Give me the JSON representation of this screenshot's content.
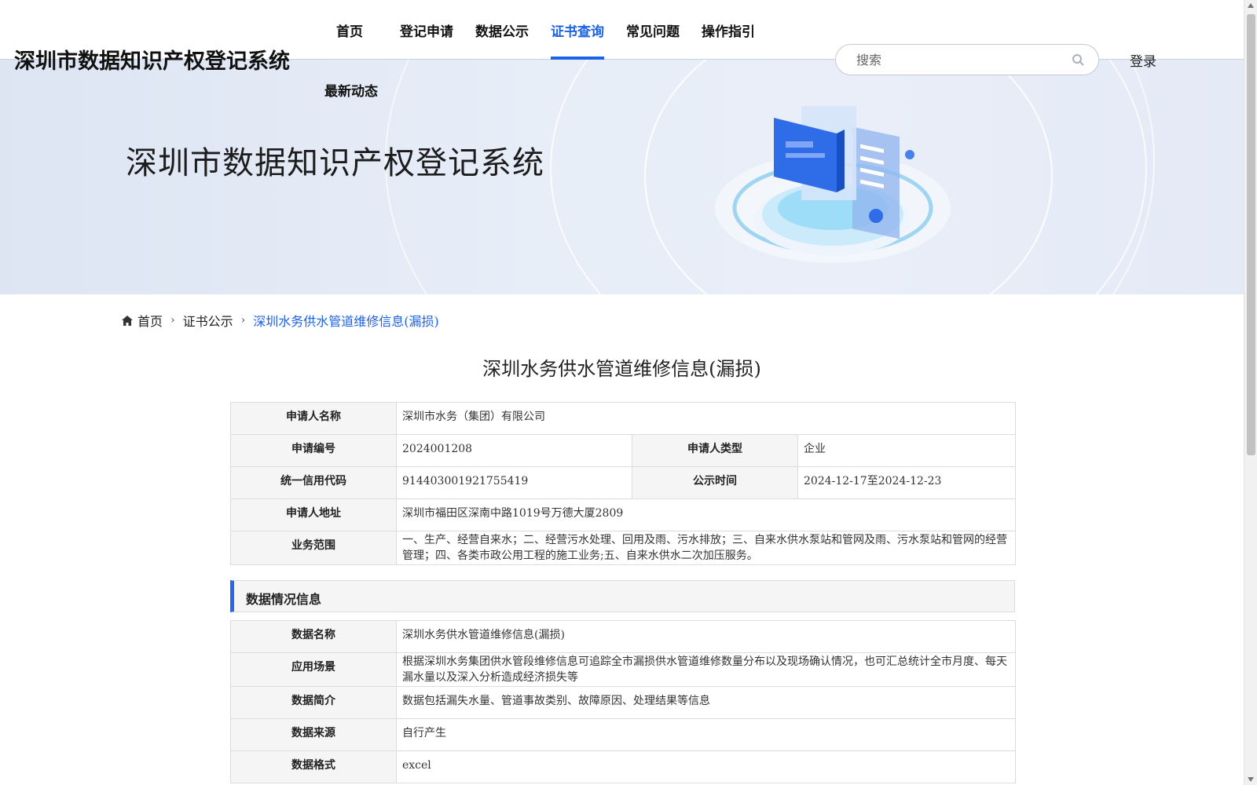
{
  "site": {
    "title": "深圳市数据知识产权登记系统"
  },
  "nav": {
    "items": [
      {
        "label": "首页"
      },
      {
        "label": "登记申请"
      },
      {
        "label": "数据公示"
      },
      {
        "label": "证书查询"
      },
      {
        "label": "常见问题"
      },
      {
        "label": "操作指引"
      },
      {
        "label": "最新动态"
      }
    ],
    "active": "证书查询"
  },
  "search": {
    "placeholder": "搜索"
  },
  "login": {
    "label": "登录"
  },
  "hero": {
    "title": "深圳市数据知识产权登记系统"
  },
  "breadcrumb": {
    "home": "首页",
    "level1": "证书公示",
    "current": "深圳水务供水管道维修信息(漏损)"
  },
  "page": {
    "title": "深圳水务供水管道维修信息(漏损)"
  },
  "applicant": {
    "name_label": "申请人名称",
    "name": "深圳市水务（集团）有限公司",
    "no_label": "申请编号",
    "no": "2024001208",
    "type_label": "申请人类型",
    "type": "企业",
    "credit_label": "统一信用代码",
    "credit": "914403001921755419",
    "public_label": "公示时间",
    "public": "2024-12-17至2024-12-23",
    "addr_label": "申请人地址",
    "addr": "深圳市福田区深南中路1019号万德大厦2809",
    "scope_label": "业务范围",
    "scope": "一、生产、经营自来水；二、经营污水处理、回用及雨、污水排放；三、自来水供水泵站和管网及雨、污水泵站和管网的经营管理；四、各类市政公用工程的施工业务;五、自来水供水二次加压服务。"
  },
  "data_section": {
    "heading": "数据情况信息",
    "name_label": "数据名称",
    "name": "深圳水务供水管道维修信息(漏损)",
    "scene_label": "应用场景",
    "scene": "根据深圳水务集团供水管段维修信息可追踪全市漏损供水管道维修数量分布以及现场确认情况，也可汇总统计全市月度、每天漏水量以及深入分析造成经济损失等",
    "intro_label": "数据简介",
    "intro": "数据包括漏失水量、管道事故类别、故障原因、处理结果等信息",
    "source_label": "数据来源",
    "source": "自行产生",
    "format_label": "数据格式",
    "format": "excel"
  }
}
